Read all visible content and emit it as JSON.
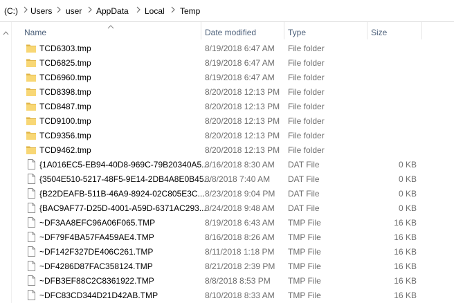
{
  "address": {
    "segments": [
      "(C:)",
      "Users",
      "user",
      "AppData",
      "Local",
      "Temp"
    ]
  },
  "columns": {
    "name": "Name",
    "date": "Date modified",
    "type": "Type",
    "size": "Size"
  },
  "files": [
    {
      "name": "TCD6303.tmp",
      "date": "8/19/2018 6:47 AM",
      "type": "File folder",
      "size": "",
      "icon": "folder-icon"
    },
    {
      "name": "TCD6825.tmp",
      "date": "8/19/2018 6:47 AM",
      "type": "File folder",
      "size": "",
      "icon": "folder-icon"
    },
    {
      "name": "TCD6960.tmp",
      "date": "8/19/2018 6:47 AM",
      "type": "File folder",
      "size": "",
      "icon": "folder-icon"
    },
    {
      "name": "TCD8398.tmp",
      "date": "8/20/2018 12:13 PM",
      "type": "File folder",
      "size": "",
      "icon": "folder-icon"
    },
    {
      "name": "TCD8487.tmp",
      "date": "8/20/2018 12:13 PM",
      "type": "File folder",
      "size": "",
      "icon": "folder-icon"
    },
    {
      "name": "TCD9100.tmp",
      "date": "8/20/2018 12:13 PM",
      "type": "File folder",
      "size": "",
      "icon": "folder-icon"
    },
    {
      "name": "TCD9356.tmp",
      "date": "8/20/2018 12:13 PM",
      "type": "File folder",
      "size": "",
      "icon": "folder-icon"
    },
    {
      "name": "TCD9462.tmp",
      "date": "8/20/2018 12:13 PM",
      "type": "File folder",
      "size": "",
      "icon": "folder-icon"
    },
    {
      "name": "{1A016EC5-EB94-40D8-969C-79B20340A5...",
      "date": "8/16/2018 8:30 AM",
      "type": "DAT File",
      "size": "0 KB",
      "icon": "file-icon"
    },
    {
      "name": "{3504E510-5217-48F5-9E14-2DB4A8E0B45...",
      "date": "8/8/2018 7:40 AM",
      "type": "DAT File",
      "size": "0 KB",
      "icon": "file-icon"
    },
    {
      "name": "{B22DEAFB-511B-46A9-8924-02C805E3C...",
      "date": "8/23/2018 9:04 PM",
      "type": "DAT File",
      "size": "0 KB",
      "icon": "file-icon"
    },
    {
      "name": "{BAC9AF77-D25D-4001-A59D-6371AC293...",
      "date": "8/24/2018 9:48 AM",
      "type": "DAT File",
      "size": "0 KB",
      "icon": "file-icon"
    },
    {
      "name": "~DF3AA8EFC96A06F065.TMP",
      "date": "8/19/2018 6:43 AM",
      "type": "TMP File",
      "size": "16 KB",
      "icon": "file-icon"
    },
    {
      "name": "~DF79F4BA57FA459AE4.TMP",
      "date": "8/16/2018 8:26 AM",
      "type": "TMP File",
      "size": "16 KB",
      "icon": "file-icon"
    },
    {
      "name": "~DF142F327DE406C261.TMP",
      "date": "8/11/2018 1:18 PM",
      "type": "TMP File",
      "size": "16 KB",
      "icon": "file-icon"
    },
    {
      "name": "~DF4286D87FAC358124.TMP",
      "date": "8/21/2018 2:39 PM",
      "type": "TMP File",
      "size": "16 KB",
      "icon": "file-icon"
    },
    {
      "name": "~DFB3EF88C2C8361922.TMP",
      "date": "8/8/2018 8:53 PM",
      "type": "TMP File",
      "size": "16 KB",
      "icon": "file-icon"
    },
    {
      "name": "~DFC83CD344D21D42AB.TMP",
      "date": "8/10/2018 8:33 AM",
      "type": "TMP File",
      "size": "16 KB",
      "icon": "file-icon"
    }
  ],
  "colors": {
    "folder": "#f8d775",
    "folder_dark": "#e0b64a",
    "header_text": "#4c607a",
    "secondary_text": "#6d6d6d"
  }
}
